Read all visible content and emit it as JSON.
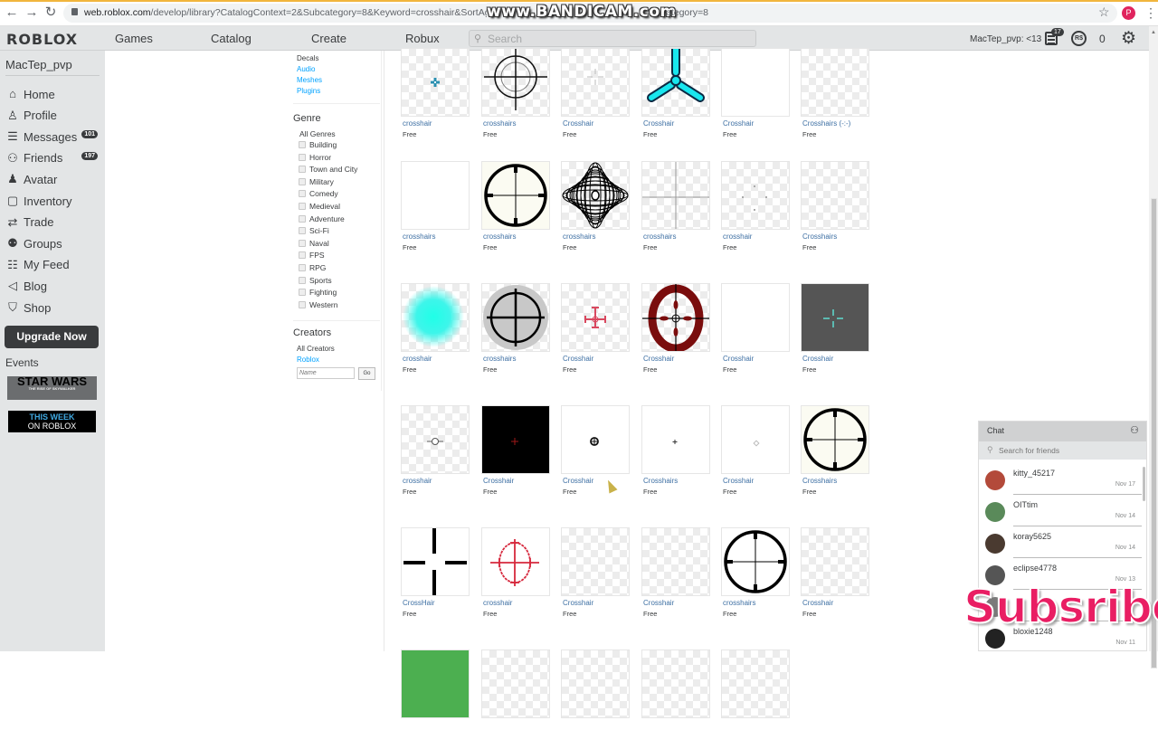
{
  "browser": {
    "url_host": "web.roblox.com",
    "url_path": "/develop/library?CatalogContext=2&Subcategory=8&Keyword=crosshair&SortAggregation",
    "url_tail": "ategory=8",
    "watermark": "www.BANDICAM.com",
    "profile_initial": "P"
  },
  "header": {
    "logo": "ROBLOX",
    "nav": [
      "Games",
      "Catalog",
      "Create",
      "Robux"
    ],
    "search_placeholder": "Search",
    "username": "MacTep_pvp: <13",
    "messages_badge": "17",
    "robux_icon": "R$",
    "robux_count": "0"
  },
  "sidebar": {
    "username": "MacTep_pvp",
    "items": [
      {
        "label": "Home",
        "icon": "home-icon",
        "glyph": "⌂"
      },
      {
        "label": "Profile",
        "icon": "profile-icon",
        "glyph": "♙"
      },
      {
        "label": "Messages",
        "icon": "messages-icon",
        "glyph": "☰",
        "badge": "101"
      },
      {
        "label": "Friends",
        "icon": "friends-icon",
        "glyph": "⚇",
        "badge": "197"
      },
      {
        "label": "Avatar",
        "icon": "avatar-icon",
        "glyph": "♟"
      },
      {
        "label": "Inventory",
        "icon": "inventory-icon",
        "glyph": "▢"
      },
      {
        "label": "Trade",
        "icon": "trade-icon",
        "glyph": "⇄"
      },
      {
        "label": "Groups",
        "icon": "groups-icon",
        "glyph": "⚉"
      },
      {
        "label": "My Feed",
        "icon": "feed-icon",
        "glyph": "☷"
      },
      {
        "label": "Blog",
        "icon": "blog-icon",
        "glyph": "◁"
      },
      {
        "label": "Shop",
        "icon": "shop-icon",
        "glyph": "⛉"
      }
    ],
    "upgrade_label": "Upgrade Now",
    "events_label": "Events",
    "event1_title": "STAR WARS",
    "event1_sub": "THE RISE OF SKYWALKER",
    "event2_line1": "THIS WEEK",
    "event2_line2": "ON ROBLOX"
  },
  "filters": {
    "categories": [
      {
        "label": "Decals",
        "current": true
      },
      {
        "label": "Audio",
        "current": false
      },
      {
        "label": "Meshes",
        "current": false
      },
      {
        "label": "Plugins",
        "current": false
      }
    ],
    "genre_heading": "Genre",
    "all_genres": "All Genres",
    "genres": [
      "Building",
      "Horror",
      "Town and City",
      "Military",
      "Comedy",
      "Medieval",
      "Adventure",
      "Sci-Fi",
      "Naval",
      "FPS",
      "RPG",
      "Sports",
      "Fighting",
      "Western"
    ],
    "creators_heading": "Creators",
    "all_creators": "All Creators",
    "creator_link": "Roblox",
    "name_placeholder": "Name",
    "go_label": "Go"
  },
  "items": [
    {
      "name": "crosshair",
      "price": "Free",
      "art": "tiny-cyan",
      "bg": "chk"
    },
    {
      "name": "crosshairs",
      "price": "Free",
      "art": "scope-thin",
      "bg": "chk"
    },
    {
      "name": "Crosshair",
      "price": "Free",
      "art": "faint-plus",
      "bg": "chk"
    },
    {
      "name": "Crosshair",
      "price": "Free",
      "art": "tri-cyan",
      "bg": "chk"
    },
    {
      "name": "Crosshair",
      "price": "Free",
      "art": "blank",
      "bg": "white"
    },
    {
      "name": "Crosshairs (-:-)",
      "price": "Free",
      "art": "blank",
      "bg": "chk"
    },
    {
      "name": "crosshairs",
      "price": "Free",
      "art": "blank",
      "bg": "white"
    },
    {
      "name": "crosshairs",
      "price": "Free",
      "art": "scope-thick",
      "bg": "cream"
    },
    {
      "name": "crosshairs",
      "price": "Free",
      "art": "ornate",
      "bg": "chk"
    },
    {
      "name": "crosshairs",
      "price": "Free",
      "art": "thin-cross",
      "bg": "chk"
    },
    {
      "name": "crosshair",
      "price": "Free",
      "art": "dots",
      "bg": "chk"
    },
    {
      "name": "Crosshairs",
      "price": "Free",
      "art": "blank",
      "bg": "chk"
    },
    {
      "name": "crosshair",
      "price": "Free",
      "art": "cyan-glow",
      "bg": "chk"
    },
    {
      "name": "crosshairs",
      "price": "Free",
      "art": "grey-scope",
      "bg": "chk"
    },
    {
      "name": "Crosshair",
      "price": "Free",
      "art": "red-small",
      "bg": "chk"
    },
    {
      "name": "Crosshair",
      "price": "Free",
      "art": "red-o",
      "bg": "chk"
    },
    {
      "name": "Crosshair",
      "price": "Free",
      "art": "blank",
      "bg": "white"
    },
    {
      "name": "Crosshair",
      "price": "Free",
      "art": "teal-plus",
      "bg": "dark"
    },
    {
      "name": "crosshair",
      "price": "Free",
      "art": "small-ring",
      "bg": "chk"
    },
    {
      "name": "Crosshair",
      "price": "Free",
      "art": "red-dot",
      "bg": "black"
    },
    {
      "name": "Crosshair",
      "price": "Free",
      "art": "circle-plus",
      "bg": "white"
    },
    {
      "name": "Crosshairs",
      "price": "Free",
      "art": "tiny-plus",
      "bg": "white"
    },
    {
      "name": "Crosshair",
      "price": "Free",
      "art": "tiny-diamond",
      "bg": "white"
    },
    {
      "name": "Crosshairs",
      "price": "Free",
      "art": "scope-thick",
      "bg": "cream"
    },
    {
      "name": "CrossHair",
      "price": "Free",
      "art": "gap-cross",
      "bg": "white"
    },
    {
      "name": "crosshair",
      "price": "Free",
      "art": "red-scope",
      "bg": "white"
    },
    {
      "name": "Crosshair",
      "price": "Free",
      "art": "blank",
      "bg": "chk"
    },
    {
      "name": "Crosshair",
      "price": "Free",
      "art": "blank",
      "bg": "chk"
    },
    {
      "name": "crosshairs",
      "price": "Free",
      "art": "scope-thick",
      "bg": "white"
    },
    {
      "name": "Crosshair",
      "price": "Free",
      "art": "blank",
      "bg": "chk"
    }
  ],
  "chat": {
    "title": "Chat",
    "search_placeholder": "Search for friends",
    "conversations": [
      {
        "name": "kitty_45217",
        "date": "Nov 17",
        "avatar_color": "#b34a3a"
      },
      {
        "name": "OITtim",
        "date": "Nov 14",
        "avatar_color": "#5a8a5a"
      },
      {
        "name": "koray5625",
        "date": "Nov 14",
        "avatar_color": "#4a3a30"
      },
      {
        "name": "eclipse4778",
        "date": "Nov 13",
        "avatar_color": "#555555"
      },
      {
        "name": "",
        "date": "",
        "avatar_color": "#7a7a7a"
      },
      {
        "name": "bloxie1248",
        "date": "Nov 11",
        "avatar_color": "#222222"
      }
    ]
  },
  "overlay_text": "Subsribe"
}
